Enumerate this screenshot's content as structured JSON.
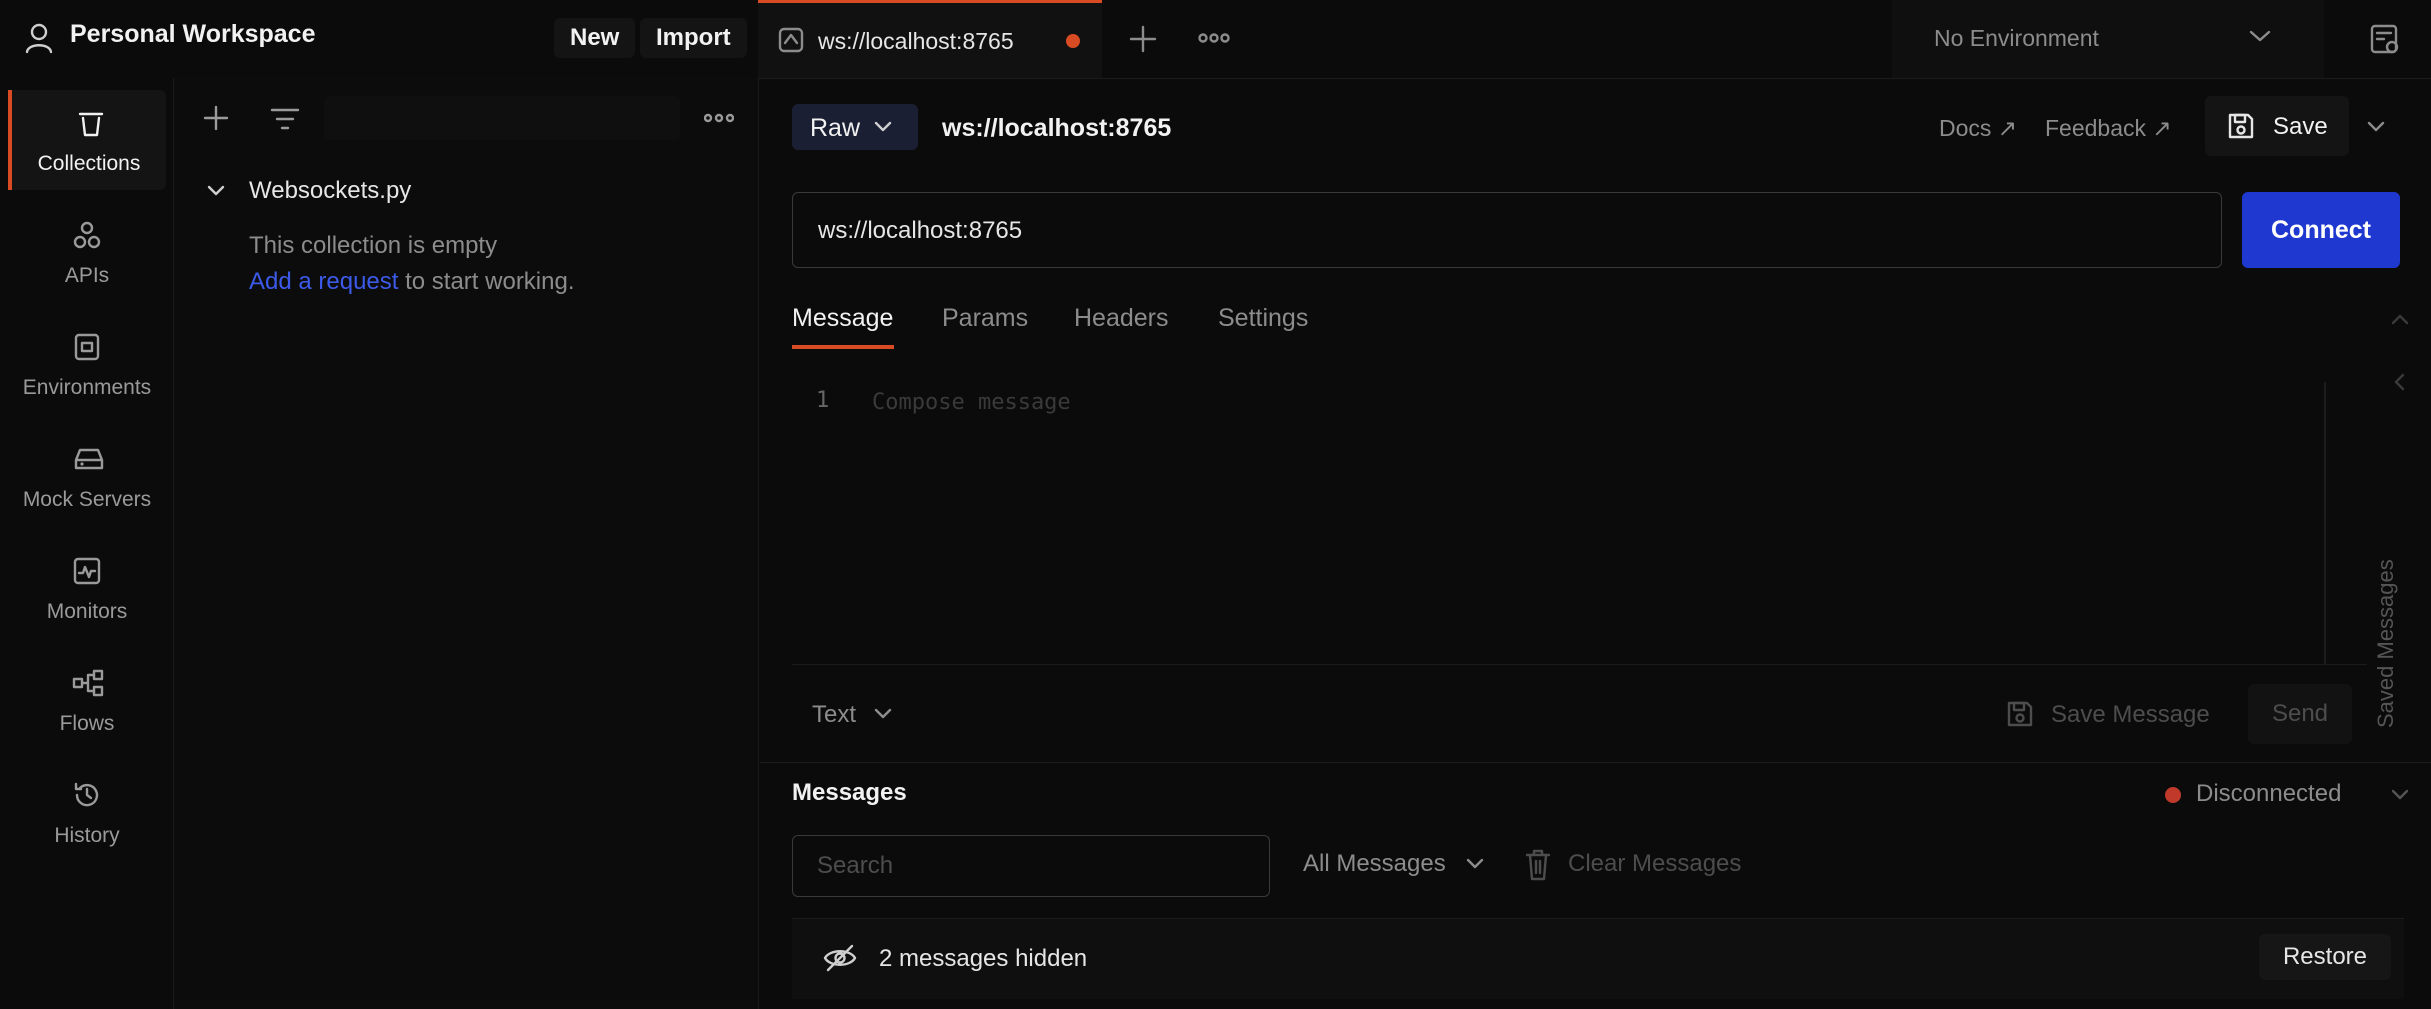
{
  "topbar": {
    "workspace_title": "Personal Workspace",
    "new_label": "New",
    "import_label": "Import",
    "active_tab_label": "ws://localhost:8765",
    "environment_label": "No Environment"
  },
  "rail": {
    "items": [
      {
        "label": "Collections",
        "icon": "collections-icon"
      },
      {
        "label": "APIs",
        "icon": "apis-icon"
      },
      {
        "label": "Environments",
        "icon": "environments-icon"
      },
      {
        "label": "Mock Servers",
        "icon": "mock-servers-icon"
      },
      {
        "label": "Monitors",
        "icon": "monitors-icon"
      },
      {
        "label": "Flows",
        "icon": "flows-icon"
      },
      {
        "label": "History",
        "icon": "history-icon"
      }
    ]
  },
  "collections": {
    "name": "Websockets.py",
    "empty_text": "This collection is empty",
    "add_link": "Add a request",
    "add_suffix": " to start working."
  },
  "request": {
    "mode": "Raw",
    "title": "ws://localhost:8765",
    "docs_label": "Docs ↗",
    "feedback_label": "Feedback ↗",
    "save_label": "Save",
    "url_value": "ws://localhost:8765",
    "connect_label": "Connect",
    "tabs": [
      "Message",
      "Params",
      "Headers",
      "Settings"
    ],
    "editor_line_number": "1",
    "editor_placeholder": "Compose message",
    "format_label": "Text",
    "save_message_label": "Save Message",
    "send_label": "Send",
    "saved_messages_label": "Saved Messages"
  },
  "messages": {
    "title": "Messages",
    "status": "Disconnected",
    "search_placeholder": "Search",
    "filter_label": "All Messages",
    "clear_label": "Clear Messages",
    "hidden_text": "2 messages hidden",
    "restore_label": "Restore"
  },
  "colors": {
    "accent": "#d84b23",
    "connect": "#1e38d0",
    "link": "#3c5ae8",
    "disconnected_dot": "#c0392b"
  }
}
